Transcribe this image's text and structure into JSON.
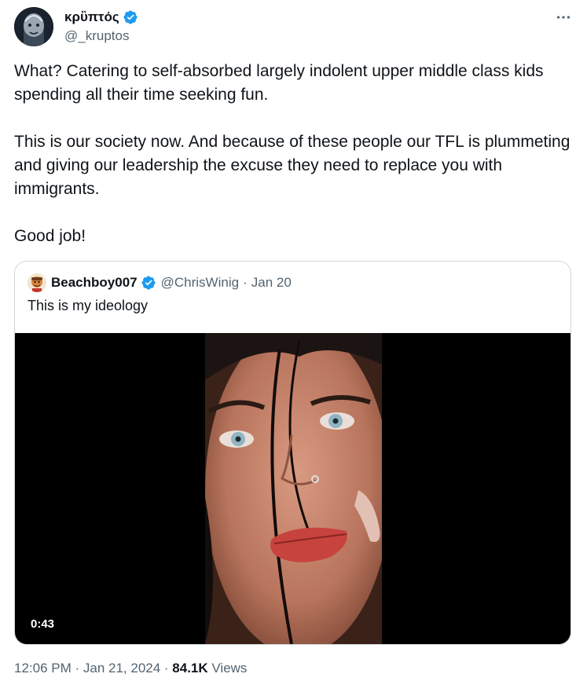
{
  "author": {
    "display_name": "κρὒπτός",
    "handle": "@_kruptos",
    "verified": true,
    "avatar_icon": "avatar-image"
  },
  "tweet": {
    "paragraphs": [
      "What? Catering to self-absorbed largely indolent upper middle class kids spending all their time seeking fun.",
      "This is our society now. And because of these people our TFL is plummeting and giving our leadership the excuse they need to replace you with immigrants.",
      "Good job!"
    ]
  },
  "quote": {
    "display_name": "Beachboy007",
    "handle": "@ChrisWinig",
    "separator": "·",
    "date": "Jan 20",
    "text": "This is my ideology",
    "verified": true,
    "video": {
      "duration": "0:43"
    }
  },
  "meta": {
    "time": "12:06 PM",
    "sep1": " · ",
    "date": "Jan 21, 2024",
    "sep2": " · ",
    "views_count": "84.1K",
    "views_label": " Views"
  },
  "colors": {
    "verified_blue": "#1d9bf0",
    "secondary_text": "#536471",
    "primary_text": "#0f1419",
    "border": "#cfd9de"
  }
}
